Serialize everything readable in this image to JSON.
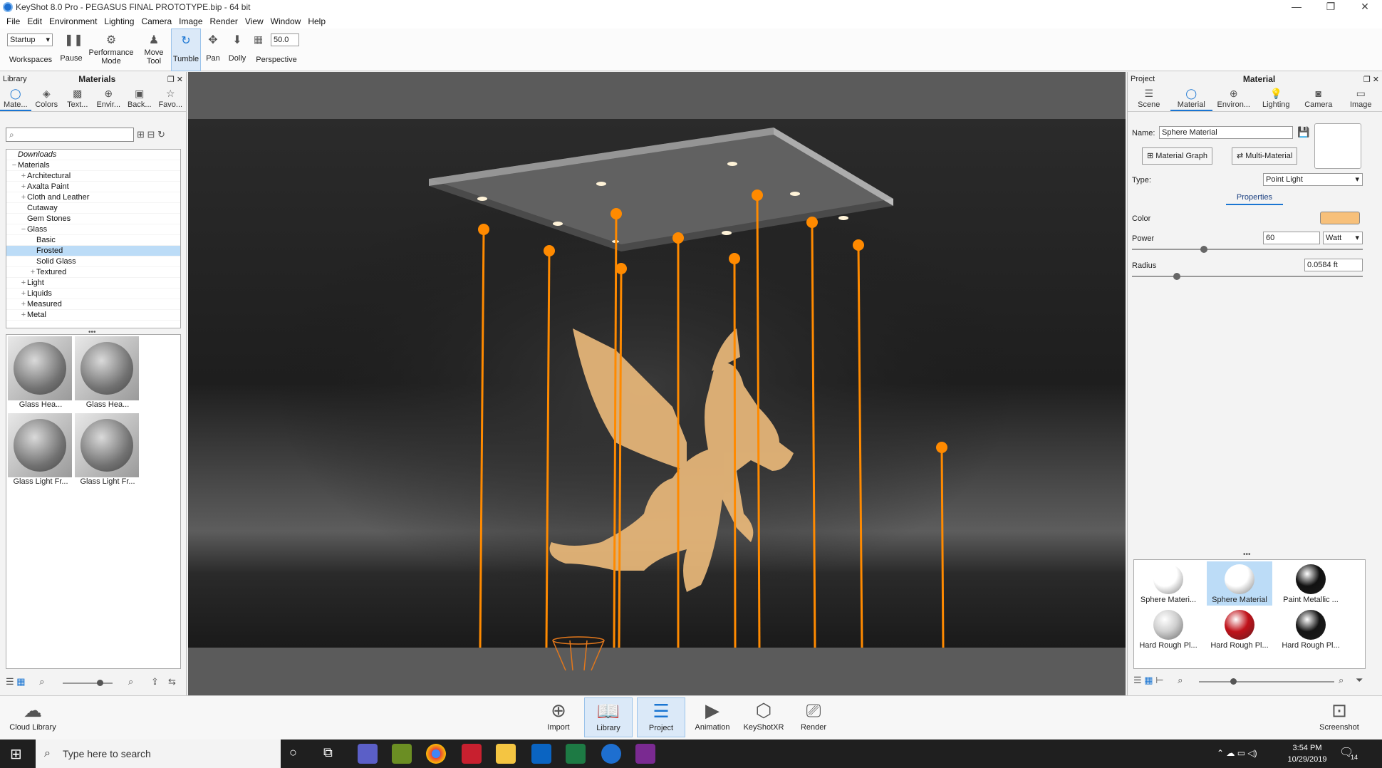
{
  "window": {
    "title": "KeyShot 8.0 Pro - PEGASUS FINAL PROTOTYPE.bip - 64 bit",
    "controls": [
      "—",
      "❐",
      "✕"
    ]
  },
  "menu": [
    "File",
    "Edit",
    "Environment",
    "Lighting",
    "Camera",
    "Image",
    "Render",
    "View",
    "Window",
    "Help"
  ],
  "toolbar": {
    "workspace_value": "Startup",
    "workspaces_label": "Workspaces",
    "pause_label": "Pause",
    "performance_label": "Performance Mode",
    "move_tool_label": "Move Tool",
    "tumble_label": "Tumble",
    "pan_label": "Pan",
    "dolly_label": "Dolly",
    "fov_value": "50.0",
    "perspective_label": "Perspective"
  },
  "library": {
    "panel_label": "Library",
    "title": "Materials",
    "tabs": [
      "Mate...",
      "Colors",
      "Text...",
      "Envir...",
      "Back...",
      "Favo..."
    ],
    "search_placeholder": "",
    "tree": [
      {
        "label": "Downloads",
        "indent": 0,
        "exp": ""
      },
      {
        "label": "Materials",
        "indent": 0,
        "exp": "−"
      },
      {
        "label": "Architectural",
        "indent": 1,
        "exp": "+"
      },
      {
        "label": "Axalta Paint",
        "indent": 1,
        "exp": "+"
      },
      {
        "label": "Cloth and Leather",
        "indent": 1,
        "exp": "+"
      },
      {
        "label": "Cutaway",
        "indent": 1,
        "exp": ""
      },
      {
        "label": "Gem Stones",
        "indent": 1,
        "exp": ""
      },
      {
        "label": "Glass",
        "indent": 1,
        "exp": "−"
      },
      {
        "label": "Basic",
        "indent": 2,
        "exp": ""
      },
      {
        "label": "Frosted",
        "indent": 2,
        "exp": "",
        "selected": true
      },
      {
        "label": "Solid Glass",
        "indent": 2,
        "exp": ""
      },
      {
        "label": "Textured",
        "indent": 2,
        "exp": "+"
      },
      {
        "label": "Light",
        "indent": 1,
        "exp": "+"
      },
      {
        "label": "Liquids",
        "indent": 1,
        "exp": "+"
      },
      {
        "label": "Measured",
        "indent": 1,
        "exp": "+"
      },
      {
        "label": "Metal",
        "indent": 1,
        "exp": "+"
      }
    ],
    "thumbnails": [
      "Glass Hea...",
      "Glass Hea...",
      "Glass Light Fr...",
      "Glass Light Fr..."
    ]
  },
  "project": {
    "panel_label": "Project",
    "title": "Material",
    "tabs": [
      "Scene",
      "Material",
      "Environ...",
      "Lighting",
      "Camera",
      "Image"
    ],
    "name_label": "Name:",
    "name_value": "Sphere Material",
    "material_graph_label": "Material Graph",
    "multi_material_label": "Multi-Material",
    "type_label": "Type:",
    "type_value": "Point Light",
    "properties_label": "Properties",
    "color_label": "Color",
    "color_value": "#f7c07a",
    "power_label": "Power",
    "power_value": "60",
    "power_unit": "Watt",
    "radius_label": "Radius",
    "radius_value": "0.0584 ft",
    "materials": [
      {
        "label": "Sphere Materi...",
        "color": "#ffffff",
        "selected": false
      },
      {
        "label": "Sphere Material",
        "color": "#ffffff",
        "selected": true
      },
      {
        "label": "Paint Metallic ...",
        "color": "#111111",
        "selected": false
      },
      {
        "label": "Hard Rough Pl...",
        "color": "#cfcfcf",
        "selected": false
      },
      {
        "label": "Hard Rough Pl...",
        "color": "#c0121a",
        "selected": false
      },
      {
        "label": "Hard Rough Pl...",
        "color": "#151515",
        "selected": false
      }
    ]
  },
  "bottom": {
    "cloud_library_label": "Cloud Library",
    "import_label": "Import",
    "library_label": "Library",
    "project_label": "Project",
    "animation_label": "Animation",
    "keyshotxr_label": "KeyShotXR",
    "render_label": "Render",
    "screenshot_label": "Screenshot"
  },
  "taskbar": {
    "search_placeholder": "Type here to search",
    "time": "3:54 PM",
    "date": "10/29/2019",
    "notification_count": "14"
  },
  "colors": {
    "accent": "#1a75d2",
    "light_orange": "#ff8a00"
  }
}
